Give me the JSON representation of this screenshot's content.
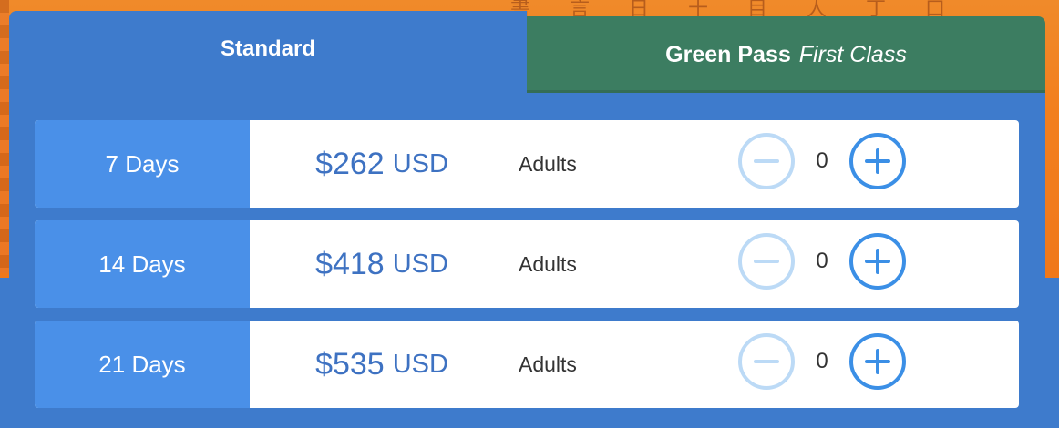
{
  "tabs": {
    "standard": {
      "label": "Standard"
    },
    "green_pass": {
      "label_strong": "Green Pass",
      "label_italic": "First Class"
    }
  },
  "passes": [
    {
      "duration": "7 Days",
      "price": "$262",
      "currency": "USD",
      "category": "Adults",
      "quantity": "0"
    },
    {
      "duration": "14 Days",
      "price": "$418",
      "currency": "USD",
      "category": "Adults",
      "quantity": "0"
    },
    {
      "duration": "21 Days",
      "price": "$535",
      "currency": "USD",
      "category": "Adults",
      "quantity": "0"
    }
  ],
  "icons": {
    "decrease": "minus-circle-icon",
    "increase": "plus-circle-icon"
  },
  "colors": {
    "standard_tab": "#3e7bcc",
    "green_pass_tab": "#3c7d61",
    "duration_cell": "#4a90e8",
    "price_text": "#3e72c2",
    "increase_button": "#3b8fe6",
    "decrease_button_disabled": "#bcdaf6"
  }
}
